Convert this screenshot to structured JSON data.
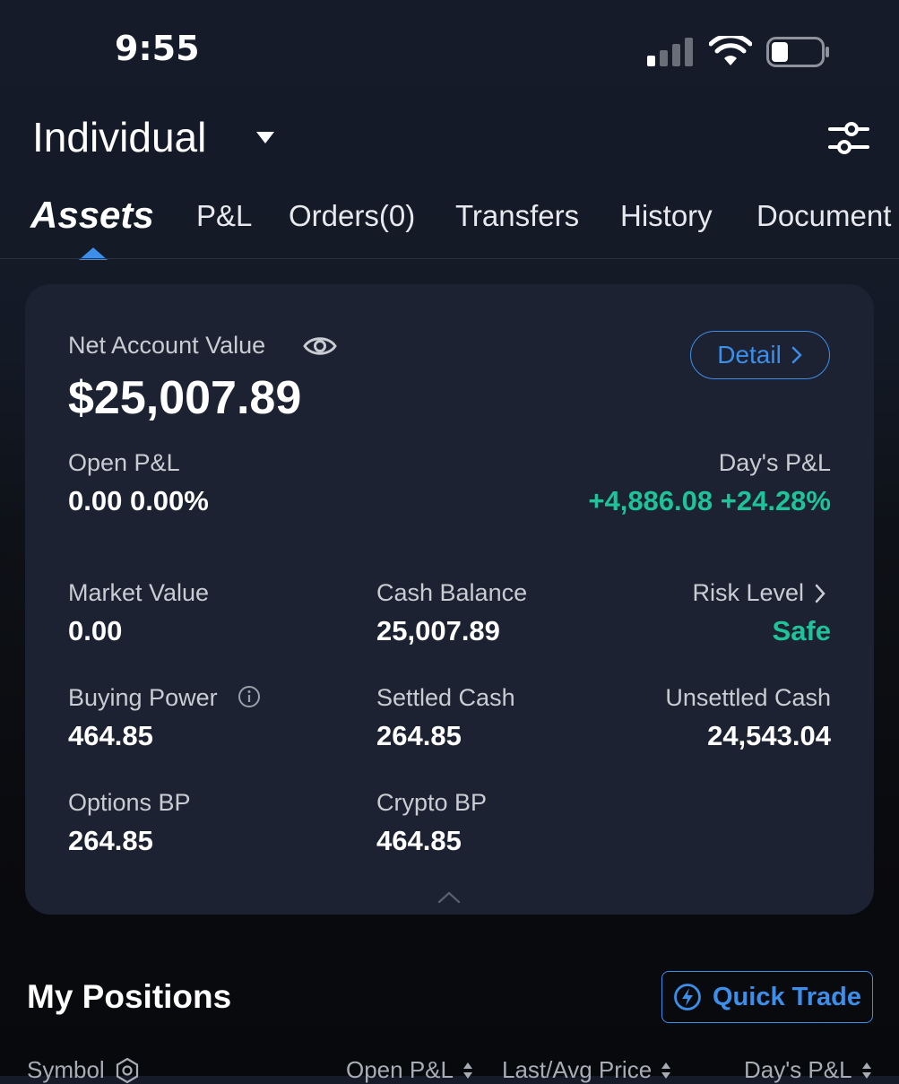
{
  "status_bar": {
    "time": "9:55"
  },
  "header": {
    "account_name": "Individual"
  },
  "tabs": [
    {
      "label": "Assets",
      "active": true
    },
    {
      "label": "P&L"
    },
    {
      "label": "Orders(0)"
    },
    {
      "label": "Transfers"
    },
    {
      "label": "History"
    },
    {
      "label": "Document"
    }
  ],
  "summary": {
    "net_account_value_label": "Net Account Value",
    "net_account_value": "$25,007.89",
    "detail_label": "Detail",
    "open_pl_label": "Open P&L",
    "open_pl_value": "0.00 0.00%",
    "days_pl_label": "Day's P&L",
    "days_pl_value": "+4,886.08 +24.28%",
    "market_value_label": "Market Value",
    "market_value": "0.00",
    "cash_balance_label": "Cash Balance",
    "cash_balance": "25,007.89",
    "risk_level_label": "Risk Level",
    "risk_level": "Safe",
    "buying_power_label": "Buying Power",
    "buying_power": "464.85",
    "settled_cash_label": "Settled Cash",
    "settled_cash": "264.85",
    "unsettled_cash_label": "Unsettled Cash",
    "unsettled_cash": "24,543.04",
    "options_bp_label": "Options BP",
    "options_bp": "264.85",
    "crypto_bp_label": "Crypto BP",
    "crypto_bp": "464.85"
  },
  "positions": {
    "title": "My Positions",
    "quick_trade_label": "Quick Trade",
    "columns": [
      "Symbol",
      "Open P&L",
      "Last/Avg Price",
      "Day's P&L"
    ]
  },
  "colors": {
    "accent": "#3c8ee8",
    "positive": "#1ec39a",
    "card": "#1c2231"
  }
}
